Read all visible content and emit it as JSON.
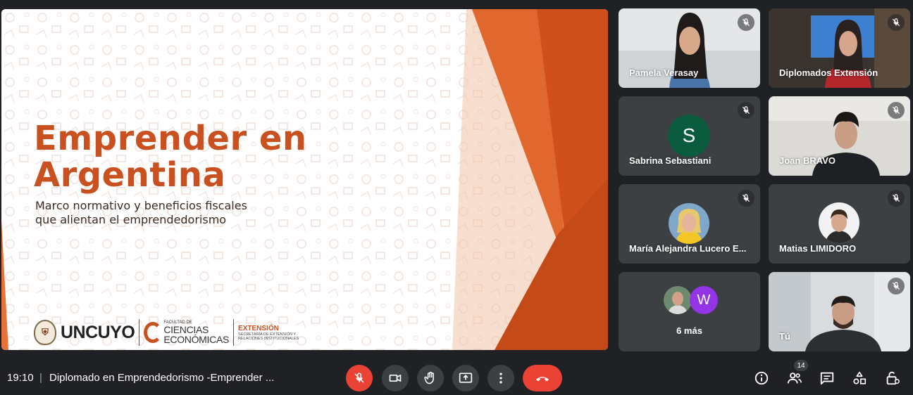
{
  "slide": {
    "title_line1": "Emprender en",
    "title_line2": "Argentina",
    "subtitle_line1": "Marco normativo y beneficios fiscales",
    "subtitle_line2": "que alientan el emprendedorismo",
    "logos": {
      "uncuyo": "UNCUYO",
      "fce_small1": "FACULTAD DE",
      "fce_big1": "CIENCIAS",
      "fce_big2": "ECONÓMICAS",
      "ext_title": "EXTENSIÓN",
      "ext_small1": "SECRETARÍA DE EXTENSIÓN Y",
      "ext_small2": "RELACIONES INSTITUCIONALES"
    },
    "colors": {
      "accent": "#c8511f",
      "orange_light": "#f08a4b",
      "orange_dark": "#d0501c"
    }
  },
  "participants": [
    {
      "name": "Pamela Verasay",
      "muted": true,
      "type": "video"
    },
    {
      "name": "Diplomados Extensión",
      "muted": true,
      "type": "video"
    },
    {
      "name": "Sabrina Sebastiani",
      "muted": true,
      "type": "avatar",
      "initial": "S",
      "color": "#0b5c3e"
    },
    {
      "name": "Joan BRAVO",
      "muted": true,
      "type": "video"
    },
    {
      "name": "María Alejandra Lucero E...",
      "muted": true,
      "type": "photo"
    },
    {
      "name": "Matias LIMIDORO",
      "muted": true,
      "type": "photo"
    },
    {
      "name": "6 más",
      "type": "more",
      "initial": "W",
      "color": "#9334e6"
    },
    {
      "name": "Tú",
      "muted": true,
      "type": "video"
    }
  ],
  "bottom_bar": {
    "time": "19:10",
    "separator": "|",
    "meeting_title": "Diplomado en Emprendedorismo -Emprender ...",
    "participant_count": "14",
    "icons": [
      "mic-off-icon",
      "camera-icon",
      "raise-hand-icon",
      "present-icon",
      "more-options-icon",
      "end-call-icon",
      "info-icon",
      "people-icon",
      "chat-icon",
      "activities-icon",
      "host-controls-icon"
    ]
  }
}
